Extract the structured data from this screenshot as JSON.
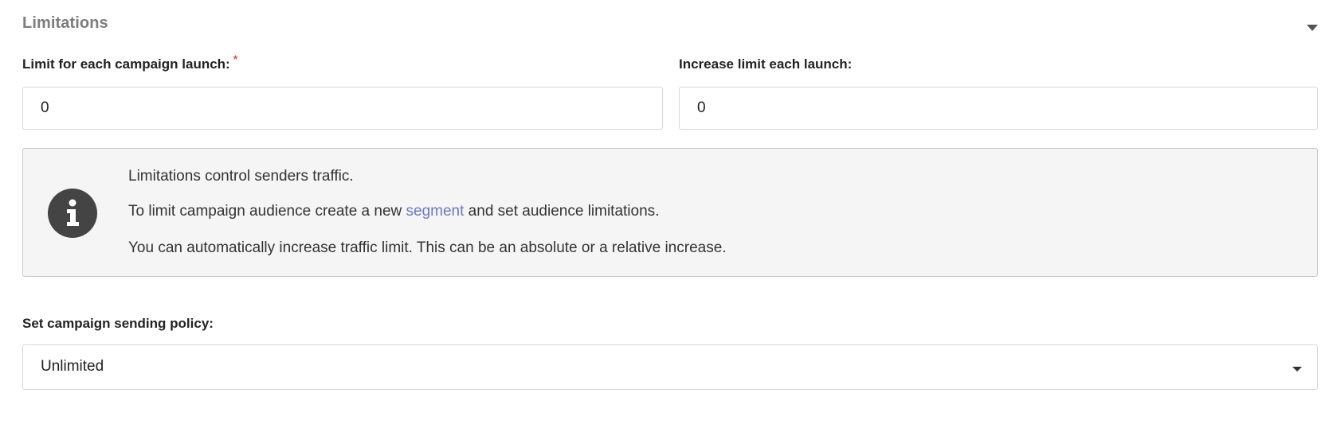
{
  "section": {
    "title": "Limitations",
    "toggle_icon": "caret-down-icon"
  },
  "fields": {
    "limit_each_launch": {
      "label": "Limit for each campaign launch:",
      "required_mark": "*",
      "value": "0"
    },
    "increase_limit": {
      "label": "Increase limit each launch:",
      "value": "0"
    }
  },
  "info": {
    "icon": "info-circle-icon",
    "line1": "Limitations control senders traffic.",
    "line2_before": "To limit campaign audience create a new ",
    "line2_link": "segment",
    "line2_after": " and set audience limitations.",
    "line3": "You can automatically increase traffic limit. This can be an absolute or a relative increase."
  },
  "policy": {
    "label": "Set campaign sending policy:",
    "selected": "Unlimited",
    "caret_icon": "caret-down-icon"
  },
  "colors": {
    "link": "#6b78c4",
    "required": "#d9534f",
    "info_background": "#f5f5f5",
    "icon": "#444444"
  }
}
